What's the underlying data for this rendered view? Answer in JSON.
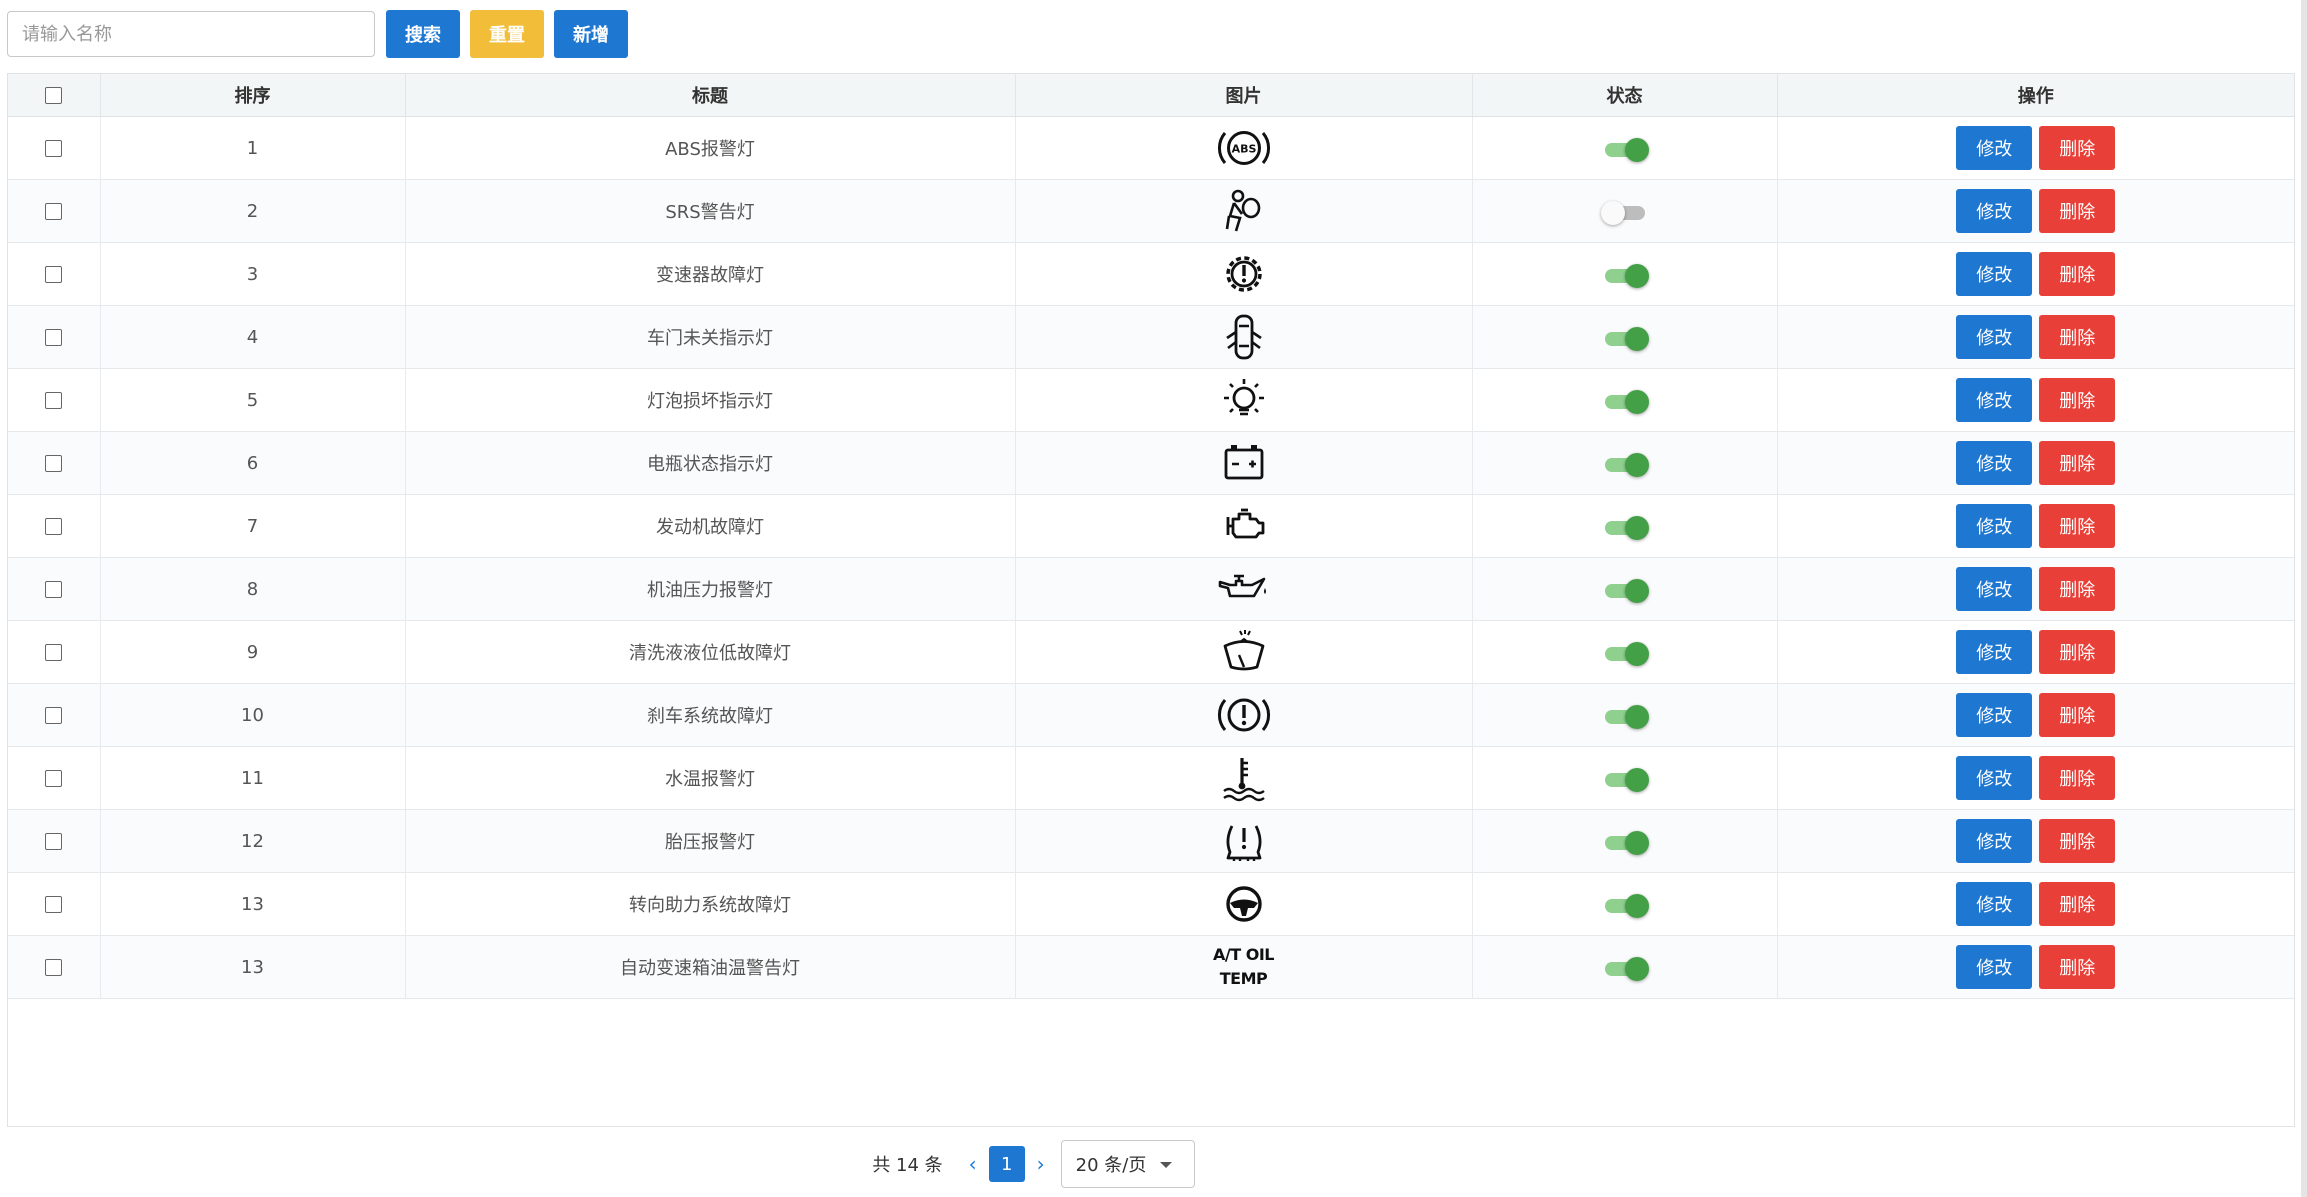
{
  "toolbar": {
    "search_placeholder": "请输入名称",
    "search_label": "搜索",
    "reset_label": "重置",
    "add_label": "新增"
  },
  "table": {
    "headers": [
      "排序",
      "标题",
      "图片",
      "状态",
      "操作"
    ],
    "edit_label": "修改",
    "delete_label": "删除",
    "rows": [
      {
        "sort": "1",
        "title": "ABS报警灯",
        "icon": "abs-warning-icon",
        "status": "on"
      },
      {
        "sort": "2",
        "title": "SRS警告灯",
        "icon": "airbag-warning-icon",
        "status": "off"
      },
      {
        "sort": "3",
        "title": "变速器故障灯",
        "icon": "transmission-fault-icon",
        "status": "on"
      },
      {
        "sort": "4",
        "title": "车门未关指示灯",
        "icon": "door-open-icon",
        "status": "on"
      },
      {
        "sort": "5",
        "title": "灯泡损坏指示灯",
        "icon": "bulb-failure-icon",
        "status": "on"
      },
      {
        "sort": "6",
        "title": "电瓶状态指示灯",
        "icon": "battery-icon",
        "status": "on"
      },
      {
        "sort": "7",
        "title": "发动机故障灯",
        "icon": "engine-check-icon",
        "status": "on"
      },
      {
        "sort": "8",
        "title": "机油压力报警灯",
        "icon": "oil-pressure-icon",
        "status": "on"
      },
      {
        "sort": "9",
        "title": "清洗液液位低故障灯",
        "icon": "washer-fluid-icon",
        "status": "on"
      },
      {
        "sort": "10",
        "title": "刹车系统故障灯",
        "icon": "brake-warning-icon",
        "status": "on"
      },
      {
        "sort": "11",
        "title": "水温报警灯",
        "icon": "coolant-temp-icon",
        "status": "on"
      },
      {
        "sort": "12",
        "title": "胎压报警灯",
        "icon": "tire-pressure-icon",
        "status": "on"
      },
      {
        "sort": "13",
        "title": "转向助力系统故障灯",
        "icon": "steering-assist-icon",
        "status": "on"
      },
      {
        "sort": "13",
        "title": "自动变速箱油温警告灯",
        "icon": "at-oil-temp-icon",
        "icon_text": [
          "A/T OIL",
          "TEMP"
        ],
        "status": "on"
      }
    ]
  },
  "pagination": {
    "total_text": "共 14 条",
    "current_page": "1",
    "page_size_text": "20 条/页"
  },
  "colors": {
    "primary": "#1e78d2",
    "warning": "#f2bd38",
    "danger": "#e84038",
    "switch_on": "#43a047"
  }
}
